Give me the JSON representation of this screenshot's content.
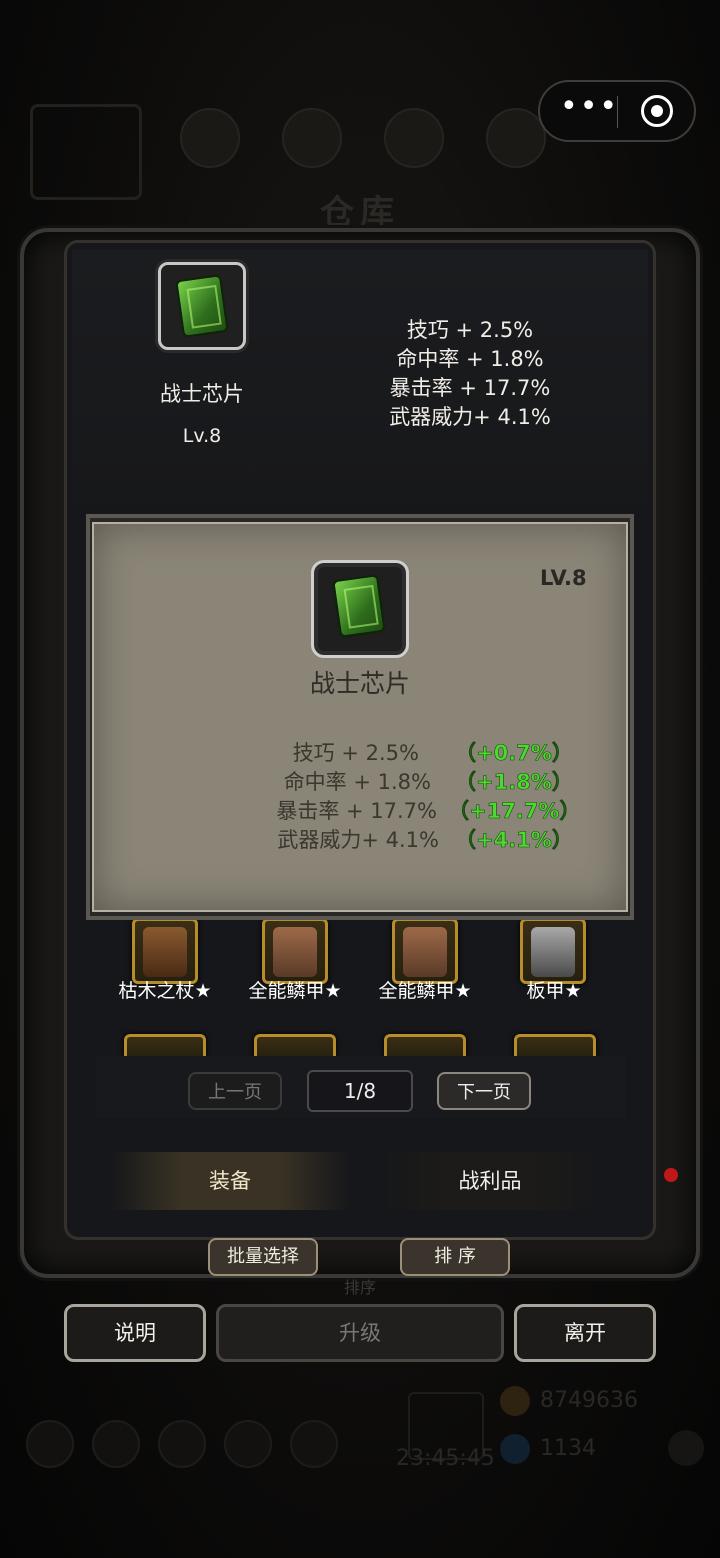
{
  "capsule": {
    "more_icon": "more-dots-icon",
    "close_icon": "record-target-icon"
  },
  "background": {
    "title": "仓库",
    "sort_label": "排序",
    "gold": "8749636",
    "gems": "1134",
    "timer": "23:45:45"
  },
  "item_summary": {
    "name": "战士芯片",
    "level": "Lv.8",
    "stats": [
      "技巧 + 2.5%",
      "命中率 + 1.8%",
      "暴击率 + 17.7%",
      "武器威力+ 4.1%"
    ]
  },
  "detail_card": {
    "level": "LV.8",
    "name": "战士芯片",
    "stats": [
      "技巧 + 2.5%",
      "命中率 + 1.8%",
      "暴击率 + 17.7%",
      "武器威力+ 4.1%"
    ],
    "gains": [
      "（+0.7%）",
      "（+1.8%）",
      "（+17.7%）",
      "（+4.1%）"
    ],
    "gain_color": "#4bdb2e"
  },
  "inventory": {
    "items": [
      {
        "label": "枯木之杖★",
        "icon": "staff-icon"
      },
      {
        "label": "全能鳞甲★",
        "icon": "armor-icon"
      },
      {
        "label": "全能鳞甲★",
        "icon": "armor-icon"
      },
      {
        "label": "板甲★",
        "icon": "plate-armor-icon"
      }
    ]
  },
  "pagination": {
    "prev": "上一页",
    "page": "1/8",
    "next": "下一页"
  },
  "tabs": {
    "equip": "装备",
    "loot": "战利品"
  },
  "actions": {
    "batch_select": "批量选择",
    "sort": "排 序"
  },
  "footer": {
    "help": "说明",
    "upgrade": "升级",
    "leave": "离开"
  }
}
